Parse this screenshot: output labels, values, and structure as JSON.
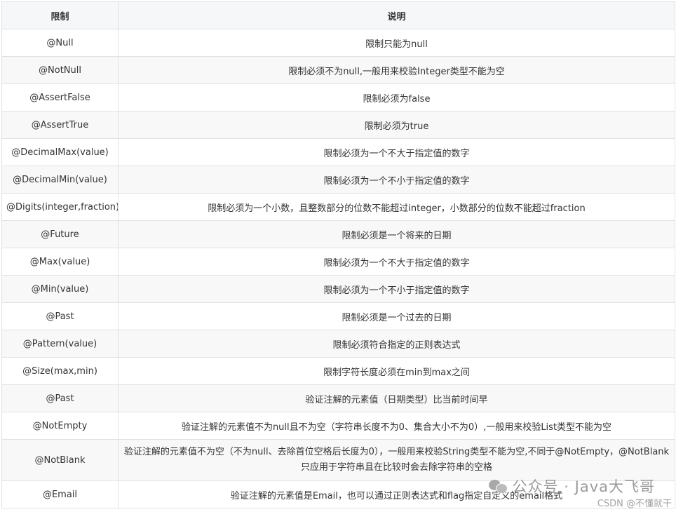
{
  "table": {
    "headers": [
      "限制",
      "说明"
    ],
    "rows": [
      {
        "name": "@Null",
        "desc": "限制只能为null"
      },
      {
        "name": "@NotNull",
        "desc": "限制必须不为null,一般用来校验Integer类型不能为空"
      },
      {
        "name": "@AssertFalse",
        "desc": "限制必须为false"
      },
      {
        "name": "@AssertTrue",
        "desc": "限制必须为true"
      },
      {
        "name": "@DecimalMax(value)",
        "desc": "限制必须为一个不大于指定值的数字"
      },
      {
        "name": "@DecimalMin(value)",
        "desc": "限制必须为一个不小于指定值的数字"
      },
      {
        "name": "@Digits(integer,fraction)",
        "desc": "限制必须为一个小数，且整数部分的位数不能超过integer，小数部分的位数不能超过fraction"
      },
      {
        "name": "@Future",
        "desc": "限制必须是一个将来的日期"
      },
      {
        "name": "@Max(value)",
        "desc": "限制必须为一个不大于指定值的数字"
      },
      {
        "name": "@Min(value)",
        "desc": "限制必须为一个不小于指定值的数字"
      },
      {
        "name": "@Past",
        "desc": "限制必须是一个过去的日期"
      },
      {
        "name": "@Pattern(value)",
        "desc": "限制必须符合指定的正则表达式"
      },
      {
        "name": "@Size(max,min)",
        "desc": "限制字符长度必须在min到max之间"
      },
      {
        "name": "@Past",
        "desc": "验证注解的元素值（日期类型）比当前时间早"
      },
      {
        "name": "@NotEmpty",
        "desc": "验证注解的元素值不为null且不为空（字符串长度不为0、集合大小不为0）,一般用来校验List类型不能为空"
      },
      {
        "name": "@NotBlank",
        "desc": "验证注解的元素值不为空（不为null、去除首位空格后长度为0），一般用来校验String类型不能为空,不同于@NotEmpty，@NotBlank只应用于字符串且在比较时会去除字符串的空格"
      },
      {
        "name": "@Email",
        "desc": "验证注解的元素值是Email，也可以通过正则表达式和flag指定自定义的email格式"
      }
    ]
  },
  "watermark": {
    "account": "公众号 · Java大飞哥",
    "csdn": "CSDN @不懂就干"
  },
  "icons": [
    "wechat-icon"
  ]
}
